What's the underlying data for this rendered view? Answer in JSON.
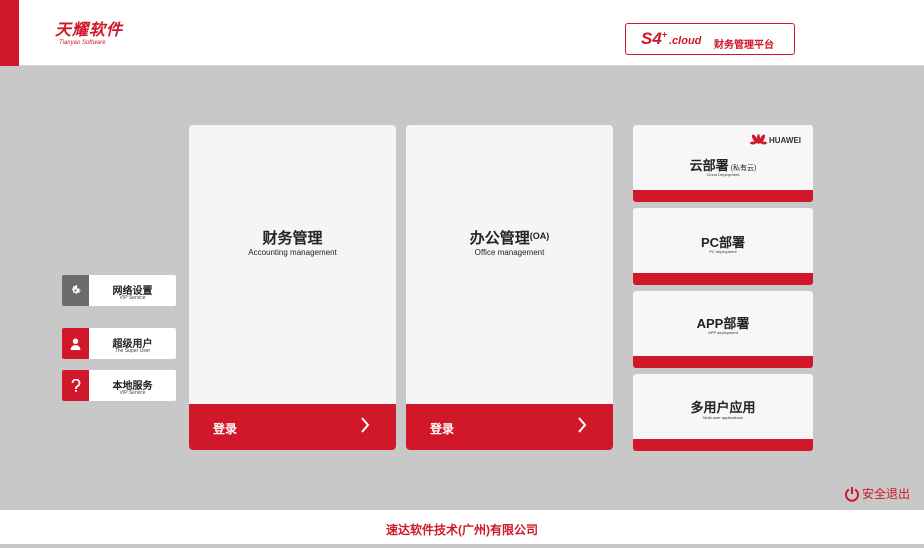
{
  "brand": {
    "name_cn": "天耀软件",
    "name_en": "Tianyao Software",
    "accent_color": "#d0182a"
  },
  "platform": {
    "prefix": "S4",
    "sup": "+",
    "suffix": ".cloud",
    "name": "财务管理平台"
  },
  "side_menu": [
    {
      "title": "网络设置",
      "subtitle": "VIP Service",
      "icon": "gear-icon"
    },
    {
      "title": "超级用户",
      "subtitle": "The Super User",
      "icon": "user-icon"
    },
    {
      "title": "本地服务",
      "subtitle": "VIP Service",
      "icon": "question-icon"
    }
  ],
  "cards": [
    {
      "title": "财务管理",
      "title_sup": "",
      "subtitle": "Accounting management",
      "login_label": "登录"
    },
    {
      "title": "办公管理",
      "title_sup": "(OA)",
      "subtitle": "Office management",
      "login_label": "登录"
    }
  ],
  "deploy": [
    {
      "title": "云部署",
      "paren": "(私有云)",
      "subtitle": "Cloud Deployment",
      "partner": "HUAWEI"
    },
    {
      "title": "PC部署",
      "paren": "",
      "subtitle": "PC deployment"
    },
    {
      "title": "APP部署",
      "paren": "",
      "subtitle": "APP deployment"
    },
    {
      "title": "多用户应用",
      "paren": "",
      "subtitle": "Multi-user applications"
    }
  ],
  "exit_label": "安全退出",
  "footer": {
    "company": "速达软件技术(广州)有限公司"
  }
}
